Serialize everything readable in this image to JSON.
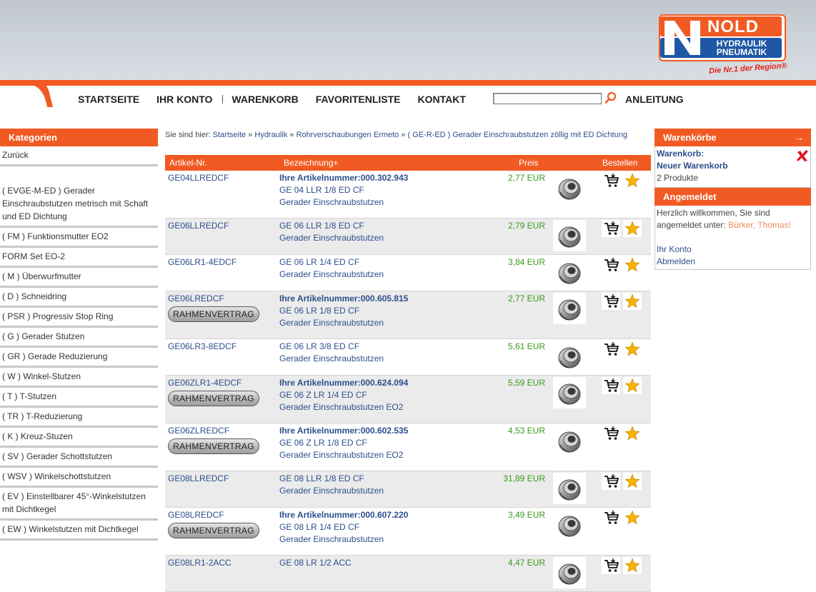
{
  "brand": {
    "name": "NOLD",
    "line1": "HYDRAULIK",
    "line2": "PNEUMATIK",
    "slogan": "Die Nr.1 der Region®",
    "accent_color": "#f15a22",
    "secondary_color": "#1f57a6"
  },
  "nav": {
    "items": [
      "STARTSEITE",
      "IHR KONTO",
      "WARENKORB",
      "FAVORITENLISTE",
      "KONTAKT"
    ],
    "search_placeholder": "",
    "search_icon": "search-icon",
    "guide": "ANLEITUNG"
  },
  "sidebar": {
    "title": "Kategorien",
    "back": "Zurück",
    "items": [
      "( EVGE-M-ED ) Gerader Einschraubstutzen metrisch mit Schaft und ED Dichtung",
      "( FM ) Funktionsmutter EO2",
      "FORM Set EO-2",
      "( M ) Überwurfmutter",
      "( D ) Schneidring",
      "( PSR ) Progressiv Stop Ring",
      "( G ) Gerader Stutzen",
      "( GR ) Gerade Reduzierung",
      "( W ) Winkel-Stutzen",
      "( T ) T-Stutzen",
      "( TR ) T-Reduzierung",
      "( K ) Kreuz-Stuzen",
      "( SV ) Gerader Schottstutzen",
      "( WSV ) Winkelschottstutzen",
      "( EV ) Einstellbarer 45°-Winkelstutzen mit Dichtkegel",
      "( EW ) Winkelstutzen mit Dichtkegel"
    ]
  },
  "breadcrumb": {
    "prefix": "Sie sind hier:",
    "items": [
      "Startseite",
      "Hydraulik",
      "Rohrverschaubungen Ermeto",
      "( GE-R-ED ) Gerader Einschraubstutzen zöllig mit ED Dichtung"
    ],
    "separator": "»"
  },
  "table": {
    "headers": {
      "article": "Artikel-Nr.",
      "description": "Bezeichnung+",
      "price": "Preis",
      "order": "Bestellen"
    },
    "rows": [
      {
        "article": "GE04LLREDCF",
        "badge": "",
        "ref": "Ihre Artikelnummer:000.302.943",
        "line1": "GE 04 LLR 1/8 ED CF",
        "line2": "Gerader Einschraubstutzen",
        "price": "2,77 EUR"
      },
      {
        "article": "GE06LLREDCF",
        "badge": "",
        "ref": "",
        "line1": "GE 06 LLR 1/8 ED CF",
        "line2": "Gerader Einschraubstutzen",
        "price": "2,79 EUR"
      },
      {
        "article": "GE06LR1-4EDCF",
        "badge": "",
        "ref": "",
        "line1": "GE 06 LR 1/4 ED CF",
        "line2": "Gerader Einschraubstutzen",
        "price": "3,84 EUR"
      },
      {
        "article": "GE06LREDCF",
        "badge": "RAHMENVERTRAG",
        "ref": "Ihre Artikelnummer:000.605.815",
        "line1": "GE 06 LR 1/8 ED CF",
        "line2": "Gerader Einschraubstutzen",
        "price": "2,77 EUR"
      },
      {
        "article": "GE06LR3-8EDCF",
        "badge": "",
        "ref": "",
        "line1": "GE 06 LR 3/8 ED CF",
        "line2": "Gerader Einschraubstutzen",
        "price": "5,61 EUR"
      },
      {
        "article": "GE06ZLR1-4EDCF",
        "badge": "RAHMENVERTRAG",
        "ref": "Ihre Artikelnummer:000.624.094",
        "line1": "GE 06 Z LR 1/4 ED CF",
        "line2": "Gerader Einschraubstutzen EO2",
        "price": "5,59 EUR"
      },
      {
        "article": "GE06ZLREDCF",
        "badge": "RAHMENVERTRAG",
        "ref": "Ihre Artikelnummer:000.602.535",
        "line1": "GE 06 Z LR 1/8 ED CF",
        "line2": "Gerader Einschraubstutzen EO2",
        "price": "4,53 EUR"
      },
      {
        "article": "GE08LLREDCF",
        "badge": "",
        "ref": "",
        "line1": "GE 08 LLR 1/8 ED CF",
        "line2": "Gerader Einschraubstutzen",
        "price": "31,89 EUR"
      },
      {
        "article": "GE08LREDCF",
        "badge": "RAHMENVERTRAG",
        "ref": "Ihre Artikelnummer:000.607.220",
        "line1": "GE 08 LR 1/4 ED CF",
        "line2": "Gerader Einschraubstutzen",
        "price": "3,49 EUR"
      },
      {
        "article": "GE08LR1-2ACC",
        "badge": "",
        "ref": "",
        "line1": "GE 08 LR 1/2 ACC",
        "line2": "",
        "price": "4,47 EUR"
      }
    ]
  },
  "cart_panel": {
    "title": "Warenkörbe",
    "arrow": "→",
    "label": "Warenkorb:",
    "name": "Neuer Warenkorb",
    "count": "2 Produkte"
  },
  "login_panel": {
    "title": "Angemeldet",
    "welcome": "Herzlich willkommen, Sie sind angemeldet unter:",
    "user": "Bürker, Thomas!",
    "link_account": "Ihr Konto",
    "link_logout": "Abmelden"
  }
}
